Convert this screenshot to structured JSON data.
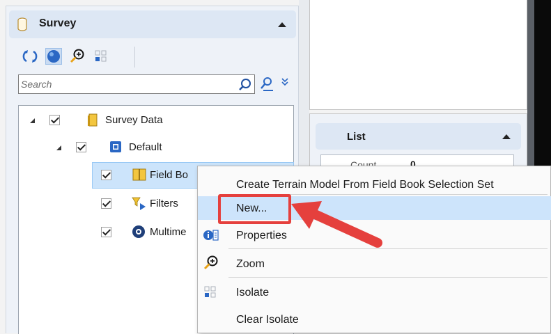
{
  "survey_panel": {
    "title": "Survey",
    "search": {
      "placeholder": "Search"
    },
    "tree": [
      {
        "label": "Survey Data",
        "checked": true,
        "expanded": true,
        "icon": "survey-data-icon"
      },
      {
        "label": "Default",
        "checked": true,
        "expanded": true,
        "icon": "default-icon"
      },
      {
        "label": "Field Bo",
        "checked": true,
        "selected": true,
        "icon": "field-book-icon"
      },
      {
        "label": "Filters",
        "checked": true,
        "icon": "filter-icon"
      },
      {
        "label": "Multime",
        "checked": true,
        "icon": "multimedia-icon"
      }
    ]
  },
  "list_panel": {
    "title": "List",
    "count_label": "Count",
    "count_value": "0"
  },
  "context_menu": {
    "items": [
      {
        "label": "Create Terrain Model From Field Book Selection Set",
        "icon": ""
      },
      {
        "label": "New...",
        "icon": "",
        "highlighted": true
      },
      {
        "label": "Properties",
        "icon": "properties-icon"
      },
      {
        "label": "Zoom",
        "icon": "zoom-icon"
      },
      {
        "label": "Isolate",
        "icon": "isolate-icon"
      },
      {
        "label": "Clear Isolate",
        "icon": ""
      }
    ]
  },
  "colors": {
    "accent": "#2a67c4",
    "selection": "#cce4fb",
    "annotation": "#e5403d"
  }
}
